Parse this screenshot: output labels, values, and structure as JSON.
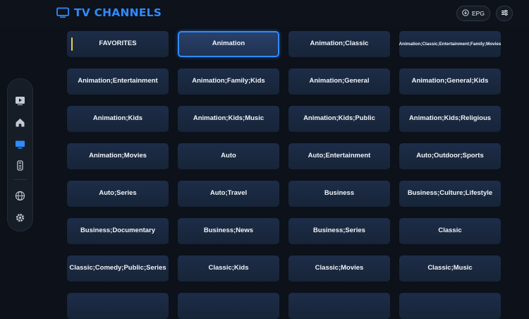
{
  "header": {
    "title": "TV CHANNELS",
    "epg_label": "EPG"
  },
  "colors": {
    "accent": "#2f8bff",
    "favorite_marker": "#e8cf3a",
    "background": "#0c111a",
    "tile": "#1b2a43"
  },
  "sidebar": {
    "items": [
      {
        "icon": "play-icon"
      },
      {
        "icon": "home-icon"
      },
      {
        "icon": "tv-icon",
        "active": true
      },
      {
        "icon": "remote-icon"
      },
      {
        "icon": "globe-icon"
      },
      {
        "icon": "gear-icon"
      }
    ]
  },
  "categories": [
    "FAVORITES",
    "Animation",
    "Animation;Classic",
    "Animation;Classic;Entertainment;Family;Movies",
    "Animation;Entertainment",
    "Animation;Family;Kids",
    "Animation;General",
    "Animation;General;Kids",
    "Animation;Kids",
    "Animation;Kids;Music",
    "Animation;Kids;Public",
    "Animation;Kids;Religious",
    "Animation;Movies",
    "Auto",
    "Auto;Entertainment",
    "Auto;Outdoor;Sports",
    "Auto;Series",
    "Auto;Travel",
    "Business",
    "Business;Culture;Lifestyle",
    "Business;Documentary",
    "Business;News",
    "Business;Series",
    "Classic",
    "Classic;Comedy;Public;Series",
    "Classic;Kids",
    "Classic;Movies",
    "Classic;Music",
    "",
    "",
    "",
    ""
  ],
  "selected_category": "Animation"
}
